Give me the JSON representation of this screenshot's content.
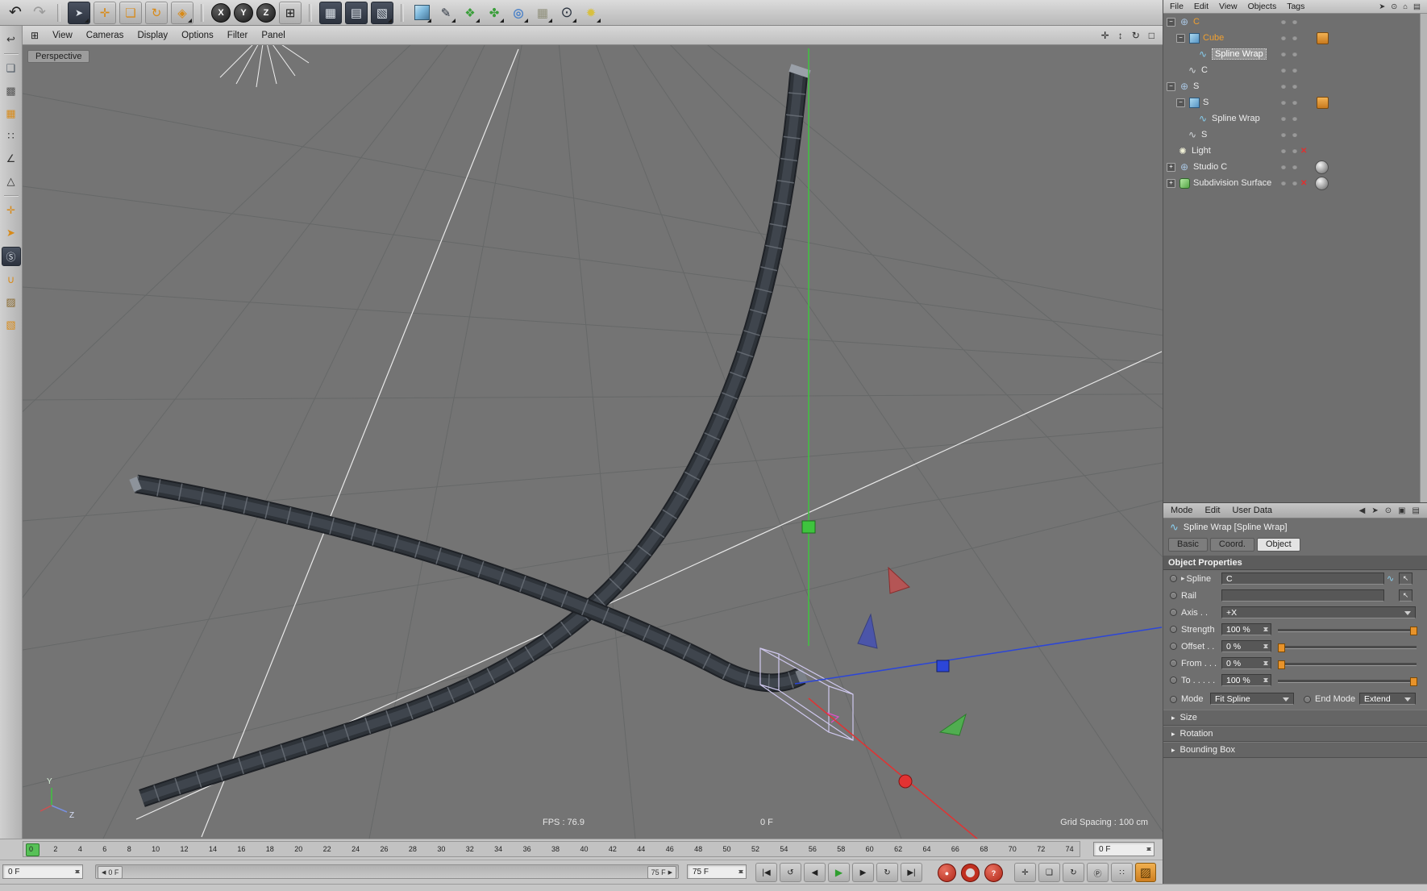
{
  "colors": {
    "accent_orange": "#e8932a",
    "axis_x": "#e23232",
    "axis_y": "#3ec43e",
    "axis_z": "#2c46d8",
    "selection_orange": "#f0a030",
    "play_green": "#2f9e2f"
  },
  "icons": {
    "triangle_right": "▸",
    "picker_arrow": "↖",
    "left_arrow": "◀",
    "right_arrow": "▶",
    "viewport_menu_grid": "⊞"
  },
  "mini_icons": {
    "null_object": "⊕",
    "spline_wrap": "∿",
    "spline": "∿",
    "light": "✺"
  },
  "top_toolbar": {
    "tools": [
      {
        "name": "undo-button",
        "glyph": "↶"
      },
      {
        "name": "redo-button",
        "glyph": "↷"
      },
      {
        "name": "live-selection-tool",
        "glyph": "➤"
      },
      {
        "name": "move-tool",
        "glyph": "✛"
      },
      {
        "name": "scale-tool",
        "glyph": "❏"
      },
      {
        "name": "rotate-tool",
        "glyph": "↻"
      },
      {
        "name": "last-used-tool",
        "glyph": "◈"
      },
      {
        "name": "lock-x-button",
        "glyph": "X"
      },
      {
        "name": "lock-y-button",
        "glyph": "Y"
      },
      {
        "name": "lock-z-button",
        "glyph": "Z"
      },
      {
        "name": "coordinate-system-button",
        "glyph": "⊞"
      },
      {
        "name": "render-view-button",
        "glyph": "▦"
      },
      {
        "name": "render-picture-viewer-button",
        "glyph": "▤"
      },
      {
        "name": "render-settings-button",
        "glyph": "▧"
      },
      {
        "name": "add-cube-button",
        "glyph": ""
      },
      {
        "name": "add-spline-button",
        "glyph": "✎"
      },
      {
        "name": "add-generator-button",
        "glyph": "❖"
      },
      {
        "name": "add-mograph-button",
        "glyph": "✤"
      },
      {
        "name": "add-deformer-button",
        "glyph": "◎"
      },
      {
        "name": "add-environment-button",
        "glyph": "▦"
      },
      {
        "name": "add-camera-button",
        "glyph": "⊙"
      },
      {
        "name": "add-light-button",
        "glyph": "✹"
      }
    ]
  },
  "left_toolbar": {
    "tools": [
      {
        "name": "undo-history-icon",
        "glyph": "↩"
      },
      {
        "name": "model-mode-icon",
        "glyph": "❑"
      },
      {
        "name": "texture-mode-icon",
        "glyph": "▩"
      },
      {
        "name": "workplane-mode-icon",
        "glyph": "▦"
      },
      {
        "name": "points-mode-icon",
        "glyph": "∷"
      },
      {
        "name": "edges-mode-icon",
        "glyph": "∠"
      },
      {
        "name": "polygons-mode-icon",
        "glyph": "△"
      },
      {
        "name": "enable-axis-icon",
        "glyph": "✛"
      },
      {
        "name": "viewport-solo-icon",
        "glyph": "➤"
      },
      {
        "name": "snap-icon",
        "glyph": "Ⓢ"
      },
      {
        "name": "magnet-icon",
        "glyph": "∪"
      },
      {
        "name": "texture-paint-icon",
        "glyph": "▨"
      },
      {
        "name": "uv-mode-icon",
        "glyph": "▧"
      }
    ]
  },
  "viewport": {
    "menus": [
      "View",
      "Cameras",
      "Display",
      "Options",
      "Filter",
      "Panel"
    ],
    "corner_icons": [
      {
        "name": "pan-view-icon",
        "glyph": "✛"
      },
      {
        "name": "dolly-view-icon",
        "glyph": "↕"
      },
      {
        "name": "rotate-view-icon",
        "glyph": "↻"
      },
      {
        "name": "toggle-view-icon",
        "glyph": "□"
      }
    ],
    "camera_label": "Perspective",
    "fps": "FPS : 76.9",
    "frame": "0 F",
    "grid_spacing": "Grid Spacing : 100 cm",
    "axis_y_label": "Y",
    "axis_z_label": "Z"
  },
  "object_manager": {
    "menus": [
      "File",
      "Edit",
      "View",
      "Objects",
      "Tags"
    ],
    "menu_icons": [
      {
        "name": "cursor-icon",
        "glyph": "➤"
      },
      {
        "name": "search-icon",
        "glyph": "⊙"
      },
      {
        "name": "home-icon",
        "glyph": "⌂"
      },
      {
        "name": "panel-icon",
        "glyph": "▤"
      }
    ],
    "items": [
      {
        "label": "C",
        "expander": "−"
      },
      {
        "label": "Cube",
        "expander": "−"
      },
      {
        "label": "Spline Wrap",
        "expander": ""
      },
      {
        "label": "C",
        "expander": ""
      },
      {
        "label": "S",
        "expander": "−"
      },
      {
        "label": "S",
        "expander": "−"
      },
      {
        "label": "Spline Wrap",
        "expander": ""
      },
      {
        "label": "S",
        "expander": ""
      },
      {
        "label": "Light",
        "expander": ""
      },
      {
        "label": "Studio C",
        "expander": "+"
      },
      {
        "label": "Subdivision Surface",
        "expander": "+"
      }
    ]
  },
  "attribute_manager": {
    "menus": [
      "Mode",
      "Edit",
      "User Data"
    ],
    "menu_icons": [
      {
        "name": "back-icon",
        "glyph": "◀"
      },
      {
        "name": "cursor-icon",
        "glyph": "➤"
      },
      {
        "name": "search-icon",
        "glyph": "⊙"
      },
      {
        "name": "lock-icon",
        "glyph": "▣"
      },
      {
        "name": "panel-icon",
        "glyph": "▤"
      }
    ],
    "title": "Spline Wrap [Spline Wrap]",
    "tabs": [
      "Basic",
      "Coord.",
      "Object"
    ],
    "section_title": "Object Properties",
    "rows": {
      "spline": {
        "label": "Spline",
        "value": "C"
      },
      "rail": {
        "label": "Rail",
        "value": ""
      },
      "axis": {
        "label": "Axis . .",
        "value": "+X"
      },
      "strength": {
        "label": "Strength",
        "value": "100 %"
      },
      "offset": {
        "label": "Offset . .",
        "value": "0 %"
      },
      "from": {
        "label": "From . . .",
        "value": "0 %"
      },
      "to": {
        "label": "To . . . . .",
        "value": "100 %"
      },
      "mode": {
        "label": "Mode",
        "value": "Fit Spline"
      },
      "end_mode": {
        "label": "End Mode",
        "value": "Extend"
      }
    },
    "collapsed_sections": [
      "Size",
      "Rotation",
      "Bounding Box"
    ]
  },
  "timeline": {
    "ticks": [
      0,
      2,
      4,
      6,
      8,
      10,
      12,
      14,
      16,
      18,
      20,
      22,
      24,
      26,
      28,
      30,
      32,
      34,
      36,
      38,
      40,
      42,
      44,
      46,
      48,
      50,
      52,
      54,
      56,
      58,
      60,
      62,
      64,
      66,
      68,
      70,
      72,
      74
    ],
    "frame_field": "0 F"
  },
  "transport": {
    "start_field": "0 F",
    "range_start": "0 F",
    "range_end": "75 F",
    "end_field": "75 F",
    "playback": [
      {
        "name": "goto-start-button",
        "glyph": "|◀"
      },
      {
        "name": "play-reverse-button",
        "glyph": "↺"
      },
      {
        "name": "previous-frame-button",
        "glyph": "◀"
      },
      {
        "name": "play-button",
        "glyph": "▶"
      },
      {
        "name": "next-frame-button",
        "glyph": "▶"
      },
      {
        "name": "loop-button",
        "glyph": "↻"
      },
      {
        "name": "goto-end-button",
        "glyph": "▶|"
      }
    ],
    "record": [
      {
        "name": "record-button",
        "glyph": "●"
      },
      {
        "name": "autokey-button",
        "glyph": ""
      },
      {
        "name": "record-options-button",
        "glyph": "?"
      }
    ],
    "tools": [
      {
        "name": "move-keys-button",
        "glyph": "✛"
      },
      {
        "name": "scale-keys-button",
        "glyph": "❏"
      },
      {
        "name": "rotate-keys-button",
        "glyph": "↻"
      },
      {
        "name": "parameter-record-button",
        "glyph": "Ⓟ"
      },
      {
        "name": "keyframe-selection-button",
        "glyph": "∷"
      },
      {
        "name": "paint-button",
        "glyph": "▨"
      }
    ]
  }
}
